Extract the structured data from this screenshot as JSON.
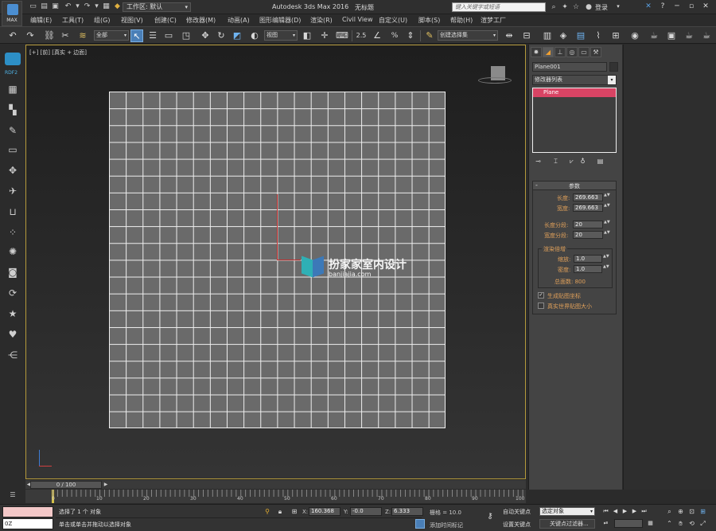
{
  "title_bar": {
    "logo_label": "MAX",
    "workspace": "工作区: 默认",
    "app_title": "Autodesk 3ds Max 2016",
    "file_name": "无标题",
    "search_placeholder": "键入关键字或短语",
    "login": "登录"
  },
  "menu": [
    "编辑(E)",
    "工具(T)",
    "组(G)",
    "视图(V)",
    "创建(C)",
    "修改器(M)",
    "动画(A)",
    "图形编辑器(D)",
    "渲染(R)",
    "Civil View",
    "自定义(U)",
    "脚本(S)",
    "帮助(H)",
    "渲梦工厂"
  ],
  "toolbar": {
    "selection_filter": "全部",
    "ref_coord": "视图",
    "snap_angle": "2.5",
    "snap_pct": "%",
    "named_selection": "创建选择集"
  },
  "left_toolbar": {
    "ribbon_label": "RDF2"
  },
  "viewport": {
    "label": "[+] [前] [真实 + 边面]",
    "watermark_title": "扮家家室内设计",
    "watermark_sub": "banjiajia.com"
  },
  "command_panel": {
    "object_name": "Plane001",
    "modifier_list": "修改器列表",
    "stack_item": "Plane",
    "rollout_title": "参数",
    "length_label": "长度:",
    "length_value": "269.663",
    "width_label": "宽度:",
    "width_value": "269.663",
    "length_segs_label": "长度分段:",
    "length_segs_value": "20",
    "width_segs_label": "宽度分段:",
    "width_segs_value": "20",
    "render_group": "渲染倍增",
    "scale_label": "缩放:",
    "scale_value": "1.0",
    "density_label": "密度:",
    "density_value": "1.0",
    "total_faces": "总面数: 800",
    "gen_map_coords": "生成贴图坐标",
    "real_world_map": "真实世界贴图大小"
  },
  "time_slider": {
    "frame_display": "0 / 100",
    "ticks": [
      "0",
      "10",
      "20",
      "30",
      "40",
      "50",
      "60",
      "70",
      "80",
      "90",
      "100"
    ]
  },
  "status": {
    "maxscript_value": "0Z",
    "selected": "选择了 1 个 对象",
    "prompt": "单击或单击并拖动以选择对象",
    "x_label": "X:",
    "x_value": "160.368",
    "y_label": "Y:",
    "y_value": "-0.0",
    "z_label": "Z:",
    "z_value": "6.333",
    "grid": "栅格 = 10.0",
    "add_time_tag": "添加时间标记",
    "auto_key": "自动关键点",
    "set_key": "设置关键点",
    "selected_objects": "选定对象",
    "key_filters": "关键点过滤器..."
  },
  "colors": {
    "viewport_border": "#b59a3b",
    "stack_highlight": "#d94464",
    "param_label": "#e0a05a",
    "active_button": "#4a7fb7"
  }
}
